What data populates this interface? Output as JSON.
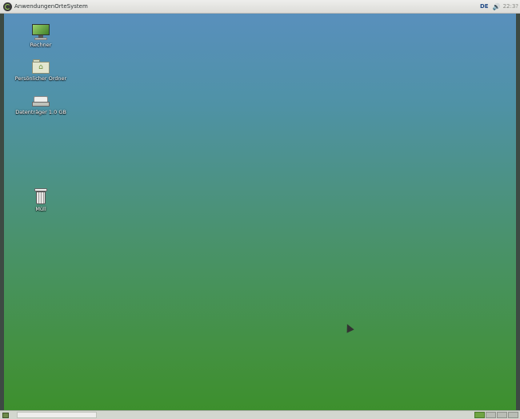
{
  "top_panel": {
    "menu": {
      "applications": "Anwendungen",
      "places": "Orte",
      "system": "System"
    },
    "keyboard_layout": "DE",
    "clock": "22:3?"
  },
  "desktop_icons": {
    "computer": "Rechner",
    "home": "Persönlicher Ordner",
    "drive": "Datenträger 1.0 GB",
    "trash": "Müll"
  },
  "bottom_panel": {
    "workspace_count": 4,
    "active_workspace": 1
  },
  "colors": {
    "desktop_top": "#5a8fc0",
    "desktop_bottom": "#3c8f2a",
    "panel": "#dcdcd8"
  }
}
